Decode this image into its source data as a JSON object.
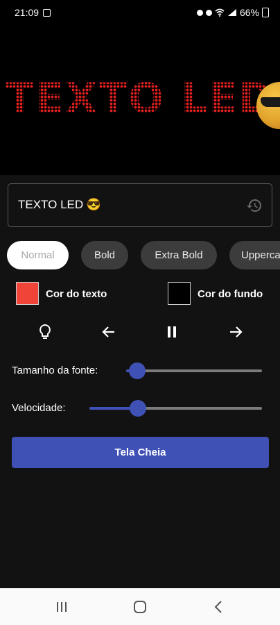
{
  "status_bar": {
    "time": "21:09",
    "battery": "66%"
  },
  "led_preview": {
    "text": "TEXTO LED",
    "emoji_icon": "sunglasses-emoji",
    "text_color": "#e82020",
    "background_color": "#000000"
  },
  "text_input": {
    "value": "TEXTO LED 😎",
    "history_icon": "history-icon"
  },
  "font_styles": [
    {
      "label": "Normal",
      "selected": true
    },
    {
      "label": "Bold",
      "selected": false
    },
    {
      "label": "Extra Bold",
      "selected": false
    },
    {
      "label": "Uppercase",
      "selected": false
    }
  ],
  "colors": {
    "text_label": "Cor do texto",
    "text_color": "#f04438",
    "background_label": "Cor do fundo",
    "background_color": "#000000"
  },
  "controls": [
    {
      "name": "lightbulb-icon"
    },
    {
      "name": "arrow-left-icon"
    },
    {
      "name": "pause-icon"
    },
    {
      "name": "arrow-right-icon"
    }
  ],
  "sliders": {
    "font_size": {
      "label": "Tamanho da fonte:",
      "value_fraction": 0.08
    },
    "speed": {
      "label": "Velocidade:",
      "value_fraction": 0.28
    }
  },
  "fullscreen_button": {
    "label": "Tela Cheia"
  },
  "nav_bar": {
    "buttons": [
      "recent-apps-icon",
      "home-icon",
      "back-icon"
    ]
  },
  "accent_color": "#3f51b5"
}
